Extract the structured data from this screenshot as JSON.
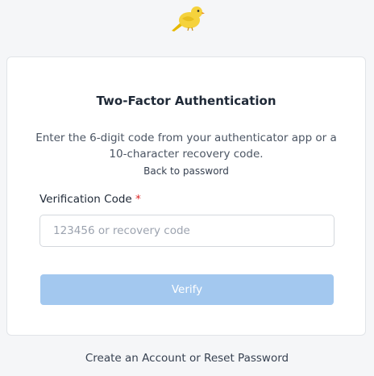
{
  "logo": {
    "icon": "canary-bird-icon",
    "color": "#f5d23c"
  },
  "card": {
    "title": "Two-Factor Authentication",
    "description": "Enter the 6-digit code from your authenticator app or a 10-character recovery code.",
    "back_link": "Back to password",
    "field": {
      "label": "Verification Code",
      "required_marker": "*",
      "value": "",
      "placeholder": "123456 or recovery code"
    },
    "submit_label": "Verify"
  },
  "footer": {
    "link": "Create an Account or Reset Password"
  },
  "colors": {
    "background": "#f5f6f8",
    "button_disabled": "#a3c8ef",
    "required": "#dc2626"
  }
}
